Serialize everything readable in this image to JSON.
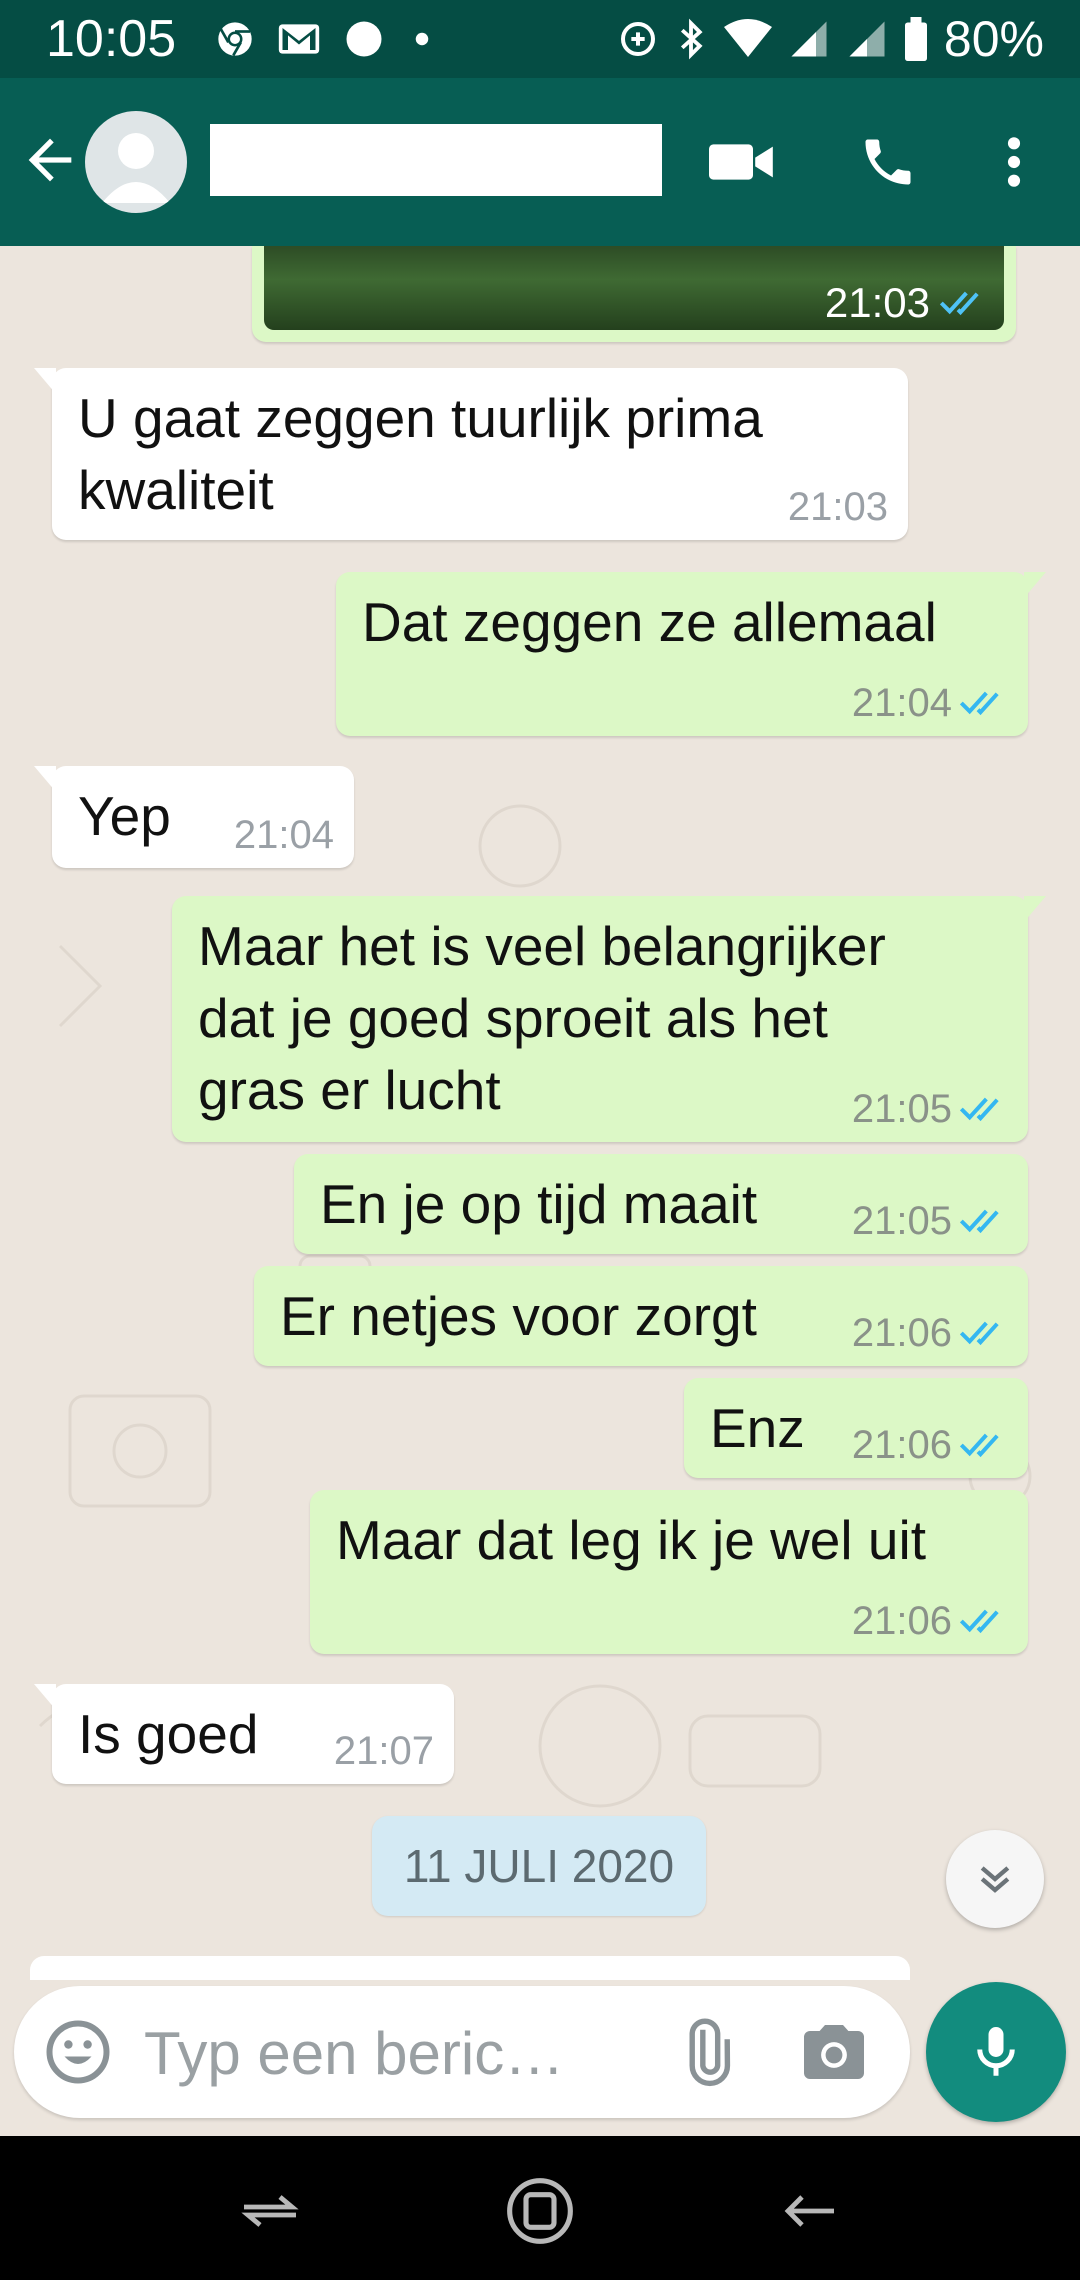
{
  "status_bar": {
    "time": "10:05",
    "battery": "80%",
    "icons": [
      "chrome-icon",
      "gmail-icon",
      "circle-icon",
      "dot-icon",
      "data-saver-icon",
      "bluetooth-icon",
      "wifi-icon",
      "signal-icon",
      "signal-icon",
      "battery-icon"
    ]
  },
  "header": {
    "contact_name": "",
    "icons": [
      "back-arrow-icon",
      "avatar-icon",
      "video-call-icon",
      "phone-icon",
      "more-vert-icon"
    ]
  },
  "messages": [
    {
      "direction": "out",
      "type": "image",
      "time": "21:03",
      "status": "read"
    },
    {
      "direction": "in",
      "lines": [
        "U gaat zeggen tuurlijk prima",
        "kwaliteit"
      ],
      "time": "21:03"
    },
    {
      "direction": "out",
      "lines": [
        "Dat zeggen ze allemaal"
      ],
      "time": "21:04",
      "status": "read"
    },
    {
      "direction": "in",
      "lines": [
        "Yep"
      ],
      "time": "21:04"
    },
    {
      "direction": "out",
      "lines": [
        "Maar het is veel belangrijker",
        "dat je goed sproeit als het",
        "gras er lucht"
      ],
      "time": "21:05",
      "status": "read"
    },
    {
      "direction": "out",
      "lines": [
        "En je op tijd maait"
      ],
      "time": "21:05",
      "status": "read"
    },
    {
      "direction": "out",
      "lines": [
        "Er netjes voor zorgt"
      ],
      "time": "21:06",
      "status": "read"
    },
    {
      "direction": "out",
      "lines": [
        "Enz"
      ],
      "time": "21:06",
      "status": "read"
    },
    {
      "direction": "out",
      "lines": [
        "Maar dat leg ik je wel uit"
      ],
      "time": "21:06",
      "status": "read"
    },
    {
      "direction": "in",
      "lines": [
        "Is goed"
      ],
      "time": "21:07"
    }
  ],
  "date_separator": "11 JULI 2020",
  "composer": {
    "placeholder": "Typ een beric…",
    "icons": [
      "emoji-icon",
      "attach-icon",
      "camera-icon",
      "mic-icon"
    ]
  },
  "colors": {
    "status_bar": "#054d44",
    "app_bar": "#075e54",
    "chat_bg": "#ece5dd",
    "outgoing_bubble": "#dcf8c6",
    "incoming_bubble": "#ffffff",
    "read_tick": "#34b7f1",
    "mic_button": "#128c7e"
  }
}
